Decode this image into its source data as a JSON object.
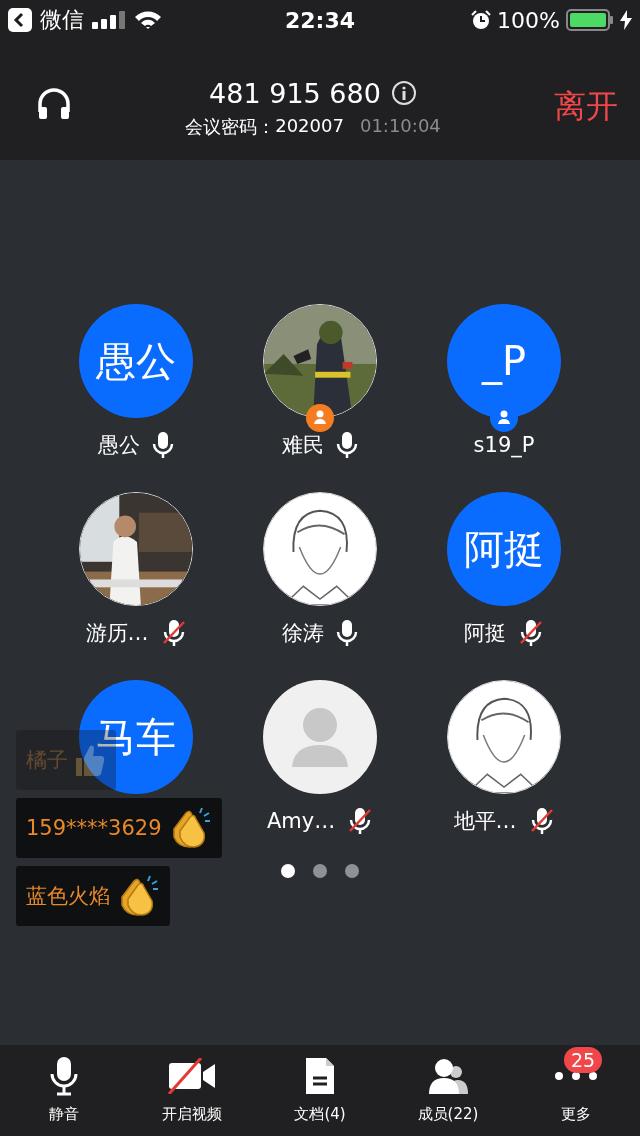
{
  "status_bar": {
    "back_label": "微信",
    "time": "22:34",
    "battery": "100%"
  },
  "header": {
    "meeting_id": "481 915 680",
    "password_label": "会议密码：",
    "password": "202007",
    "duration": "01:10:04",
    "leave": "离开"
  },
  "participants": [
    {
      "name": "愚公",
      "kind": "initials",
      "initials": "愚公",
      "muted": false
    },
    {
      "name": "难民",
      "muted": false,
      "color": "#f57c1f"
    },
    {
      "name": "s19_P",
      "kind": "initials",
      "initials": "_P",
      "color": "#0a6cff"
    },
    {
      "name": "游历…",
      "muted": true
    },
    {
      "name": "徐涛",
      "muted": false
    },
    {
      "name": "阿挺",
      "kind": "initials",
      "initials": "阿挺",
      "muted": true
    },
    {
      "kind": "initials",
      "initials": "马车"
    },
    {
      "name": "Amy…",
      "kind": "placeholder",
      "muted": true
    },
    {
      "name": "地平…",
      "muted": true
    }
  ],
  "pages": [
    {
      "selected": true
    },
    {
      "selected": false
    },
    {
      "selected": false
    }
  ],
  "reactions": [
    {
      "name": "橘子",
      "kind": "thumbs",
      "faded": true
    },
    {
      "name": "159****3629",
      "kind": "clap",
      "faded": false
    },
    {
      "name": "蓝色火焰",
      "kind": "clap",
      "faded": false
    }
  ],
  "toolbar": [
    {
      "kind": "mic",
      "label": "静音"
    },
    {
      "kind": "video-off",
      "label": "开启视频"
    },
    {
      "kind": "doc",
      "label": "文档(4)"
    },
    {
      "kind": "members",
      "label": "成员(22)"
    },
    {
      "kind": "more",
      "label": "更多",
      "badge": "25"
    }
  ]
}
